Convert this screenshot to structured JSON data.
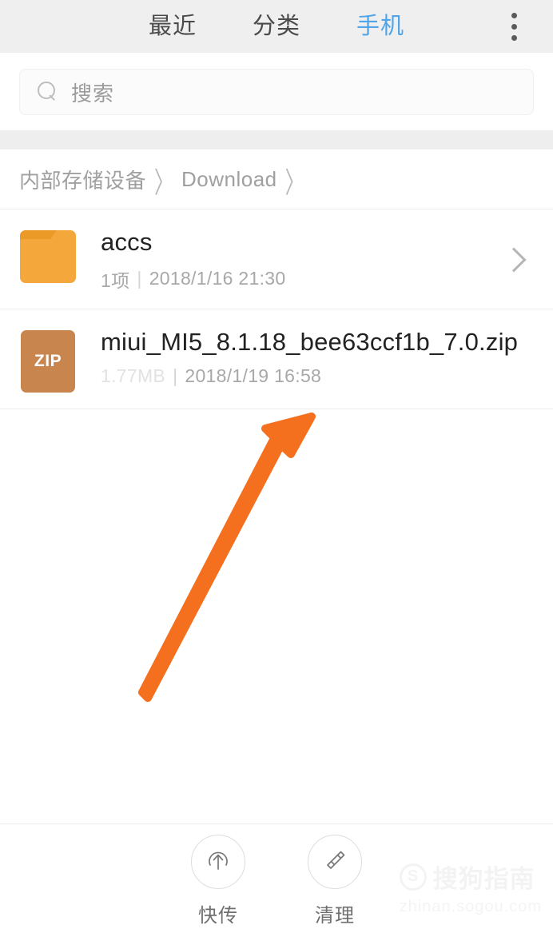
{
  "app": {
    "accent_color": "#4fa5e8",
    "arrow_color": "#f4701e"
  },
  "topbar": {
    "tabs": [
      {
        "label": "最近",
        "name": "recent",
        "active": false
      },
      {
        "label": "分类",
        "name": "category",
        "active": false
      },
      {
        "label": "手机",
        "name": "phone",
        "active": true
      }
    ],
    "overflow_icon": "more-vertical-icon"
  },
  "search": {
    "icon": "search-icon",
    "placeholder": "搜索",
    "value": ""
  },
  "breadcrumb": {
    "items": [
      {
        "label": "内部存储设备"
      },
      {
        "label": "Download"
      }
    ],
    "separator": "〉"
  },
  "files": [
    {
      "kind": "folder",
      "icon": "folder-icon",
      "name": "accs",
      "count": "1项",
      "separator": "|",
      "date": "2018/1/16 21:30",
      "chevron": "chevron-right-icon"
    },
    {
      "kind": "zip",
      "icon": "zip-file-icon",
      "icon_label": "ZIP",
      "name": "miui_MI5_8.1.18_bee63ccf1b_7.0.zip",
      "size": "1.77MB",
      "separator": "|",
      "date": "2018/1/19 16:58"
    }
  ],
  "bottombar": {
    "buttons": [
      {
        "label": "快传",
        "icon": "upload-circle-icon",
        "name": "quick-transfer"
      },
      {
        "label": "清理",
        "icon": "broom-icon",
        "name": "cleanup"
      }
    ]
  },
  "watermark": {
    "logo": "S",
    "title": "搜狗指南",
    "url": "zhinan.sogou.com"
  }
}
